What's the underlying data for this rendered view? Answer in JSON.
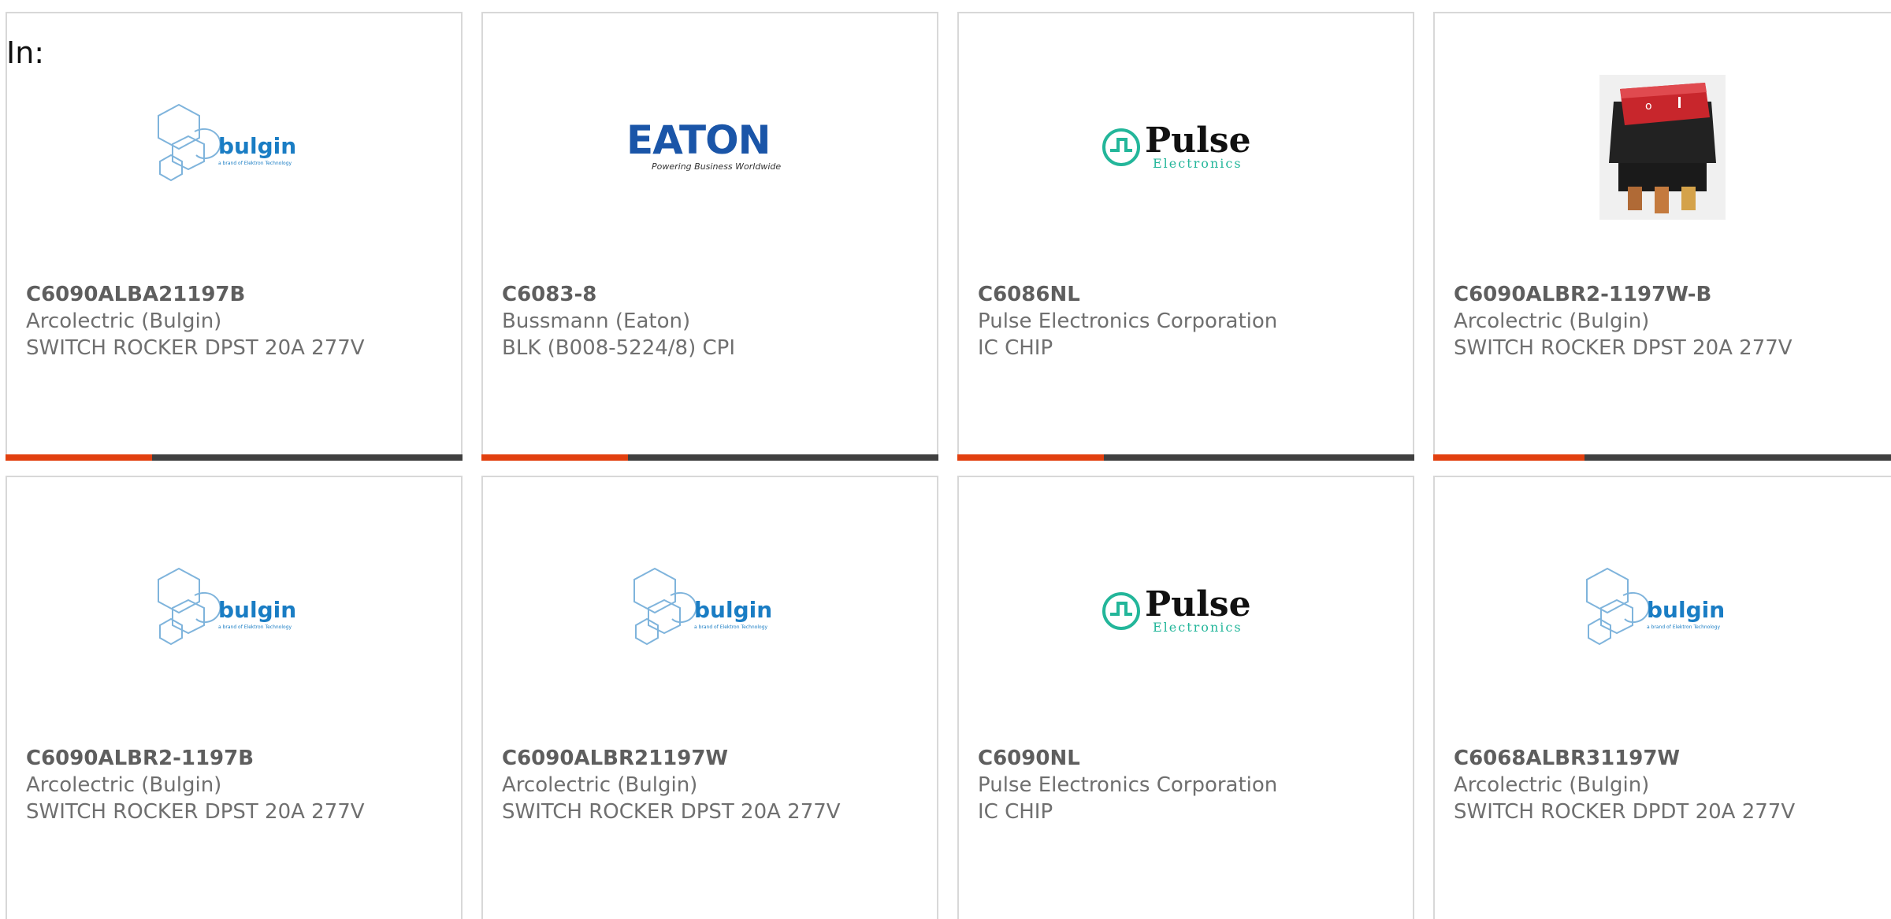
{
  "filter_label": "In:",
  "colors": {
    "accent": "#e2400f",
    "bar_track": "#404040",
    "card_border": "#d8d8d8",
    "text": "#6f6f6f",
    "bulgin_blue": "#1a7dc4",
    "pulse_green": "#23b69a",
    "eaton_blue": "#1a55a8"
  },
  "logos": {
    "bulgin": {
      "name": "bulgin",
      "tagline": "a brand of Elektron Technology"
    },
    "eaton": {
      "name": "EATON",
      "tagline": "Powering Business Worldwide"
    },
    "pulse": {
      "name": "Pulse",
      "sub": "Electronics"
    }
  },
  "products": [
    {
      "part": "C6090ALBA21197B",
      "maker": "Arcolectric (Bulgin)",
      "desc": "SWITCH ROCKER DPST 20A 277V",
      "image": "bulgin-logo",
      "progress": 0.32
    },
    {
      "part": "C6083-8",
      "maker": "Bussmann (Eaton)",
      "desc": "BLK (B008-5224/8) CPI",
      "image": "eaton-logo",
      "progress": 0.32
    },
    {
      "part": "C6086NL",
      "maker": "Pulse Electronics Corporation",
      "desc": "IC CHIP",
      "image": "pulse-logo",
      "progress": 0.32
    },
    {
      "part": "C6090ALBR2-1197W-B",
      "maker": "Arcolectric (Bulgin)",
      "desc": "SWITCH ROCKER DPST 20A 277V",
      "image": "rocker-switch-photo",
      "progress": 0.32
    },
    {
      "part": "C6090ALBR2-1197B",
      "maker": "Arcolectric (Bulgin)",
      "desc": "SWITCH ROCKER DPST 20A 277V",
      "image": "bulgin-logo"
    },
    {
      "part": "C6090ALBR21197W",
      "maker": "Arcolectric (Bulgin)",
      "desc": "SWITCH ROCKER DPST 20A 277V",
      "image": "bulgin-logo"
    },
    {
      "part": "C6090NL",
      "maker": "Pulse Electronics Corporation",
      "desc": "IC CHIP",
      "image": "pulse-logo"
    },
    {
      "part": "C6068ALBR31197W",
      "maker": "Arcolectric (Bulgin)",
      "desc": "SWITCH ROCKER DPDT 20A 277V",
      "image": "bulgin-logo"
    }
  ]
}
